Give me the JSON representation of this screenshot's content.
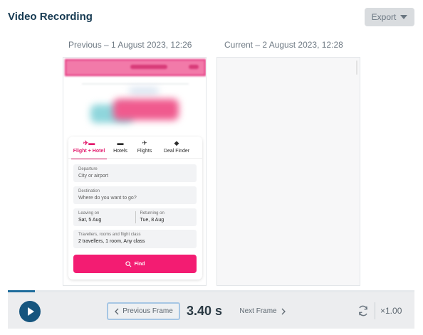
{
  "header": {
    "title": "Video Recording",
    "export_label": "Export"
  },
  "frames": {
    "previous_label": "Previous – 1 August 2023, 12:26",
    "current_label": "Current – 2 August 2023, 12:28"
  },
  "mobile_page": {
    "tabs": [
      {
        "label": "Flight + Hotel",
        "icon": "plane-bed-icon",
        "active": true
      },
      {
        "label": "Hotels",
        "icon": "bed-icon",
        "active": false
      },
      {
        "label": "Flights",
        "icon": "plane-icon",
        "active": false
      },
      {
        "label": "Deal Finder",
        "icon": "tag-icon",
        "active": false
      }
    ],
    "departure": {
      "label": "Departure",
      "value": "City or airport"
    },
    "destination": {
      "label": "Destination",
      "value": "Where do you want to go?"
    },
    "leaving": {
      "label": "Leaving on",
      "value": "Sat, 5 Aug"
    },
    "returning": {
      "label": "Returning on",
      "value": "Tue, 8 Aug"
    },
    "travellers": {
      "label": "Travellers, rooms and flight class",
      "value": "2 travellers, 1 room, Any class"
    },
    "find_label": "Find",
    "accent_color": "#f31c72"
  },
  "playback": {
    "prev_frame_label": "Previous Frame",
    "next_frame_label": "Next Frame",
    "time": "3.40 s",
    "speed": "×1.00",
    "accent_color": "#16557e"
  }
}
